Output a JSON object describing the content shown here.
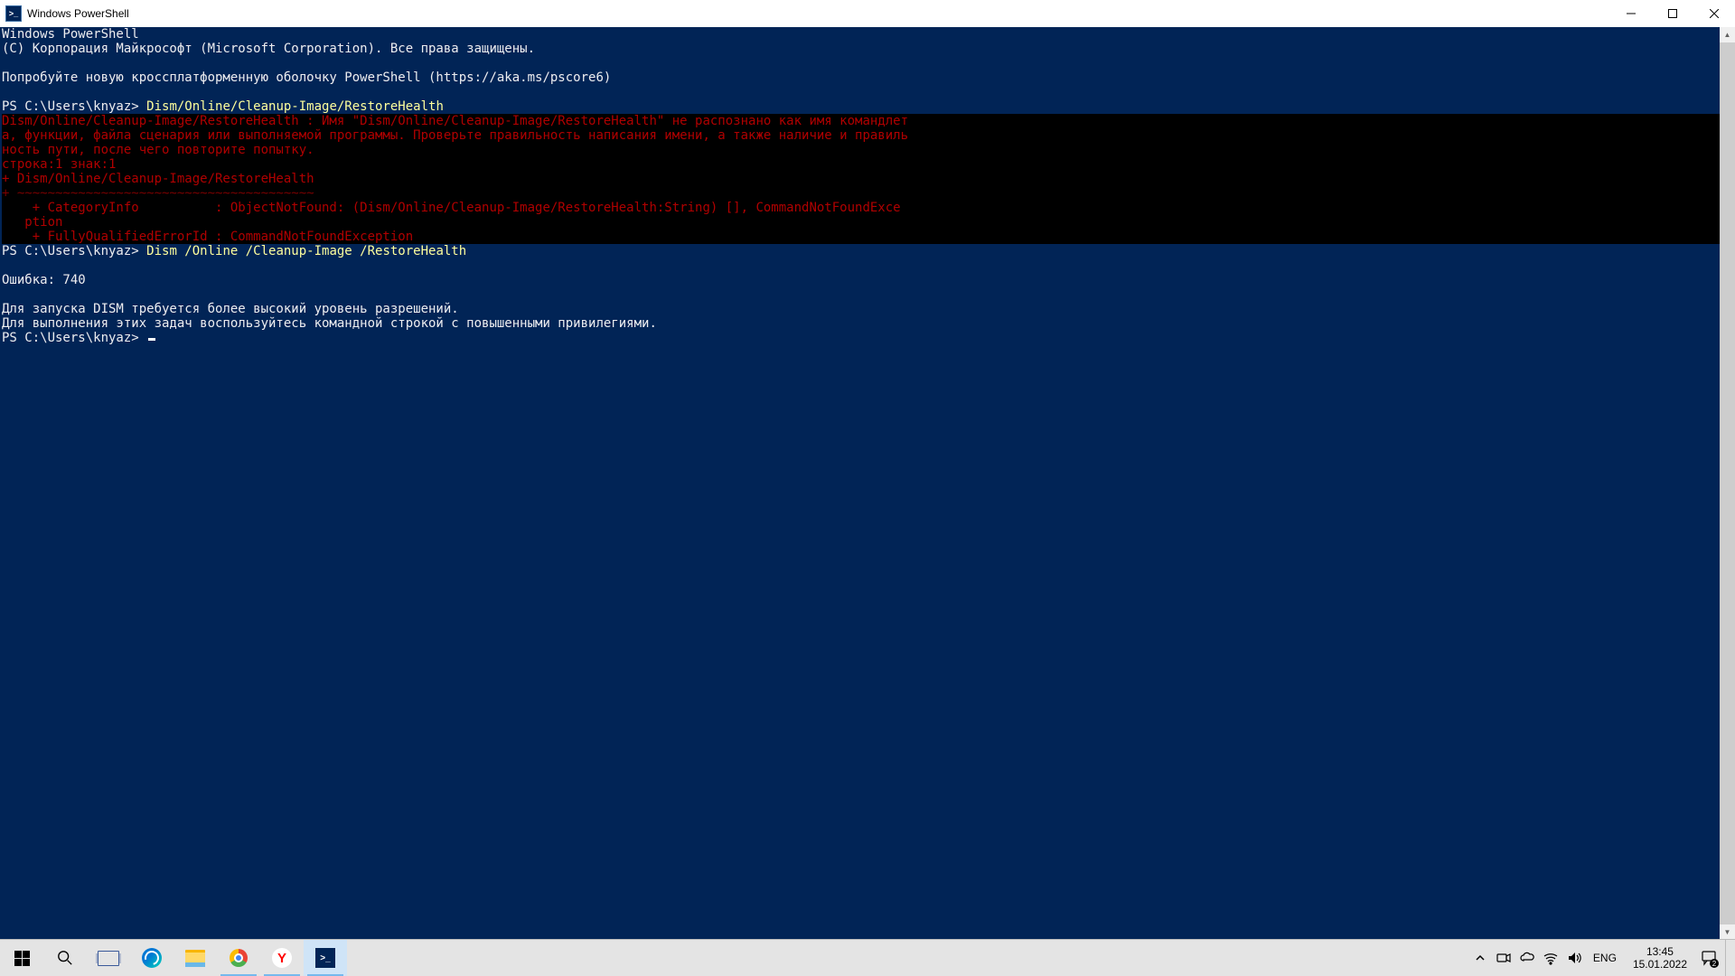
{
  "window": {
    "title": "Windows PowerShell"
  },
  "terminal": {
    "header1": "Windows PowerShell",
    "header2": "(C) Корпорация Майкрософт (Microsoft Corporation). Все права защищены.",
    "header3": "Попробуйте новую кроссплатформенную оболочку PowerShell (https://aka.ms/pscore6)",
    "prompt1_ps": "PS C:\\Users\\knyaz> ",
    "prompt1_cmd": "Dism/Online/Cleanup-Image/RestoreHealth",
    "err_l1": "Dism/Online/Cleanup-Image/RestoreHealth : Имя \"Dism/Online/Cleanup-Image/RestoreHealth\" не распознано как имя командлет",
    "err_l2": "а, функции, файла сценария или выполняемой программы. Проверьте правильность написания имени, а также наличие и правиль",
    "err_l3": "ность пути, после чего повторите попытку.",
    "err_l4": "строка:1 знак:1",
    "err_l5": "+ Dism/Online/Cleanup-Image/RestoreHealth",
    "err_l6": "+ ~~~~~~~~~~~~~~~~~~~~~~~~~~~~~~~~~~~~~~~",
    "err_l7": "    + CategoryInfo          : ObjectNotFound: (Dism/Online/Cleanup-Image/RestoreHealth:String) [], CommandNotFoundExce",
    "err_l8": "   ption",
    "err_l9": "    + FullyQualifiedErrorId : CommandNotFoundException",
    "prompt2_ps": "PS C:\\Users\\knyaz> ",
    "prompt2_cmd": "Dism /Online /Cleanup-Image /RestoreHealth",
    "out_l1": "Ошибка: 740",
    "out_l2": "Для запуска DISM требуется более высокий уровень разрешений.",
    "out_l3": "Для выполнения этих задач воспользуйтесь командной строкой с повышенными привилегиями.",
    "prompt3_ps": "PS C:\\Users\\knyaz> "
  },
  "taskbar": {
    "lang": "ENG",
    "time": "13:45",
    "date": "15.01.2022",
    "notif_count": "2"
  },
  "icons": {
    "ps": ">_",
    "yandex": "Y"
  }
}
